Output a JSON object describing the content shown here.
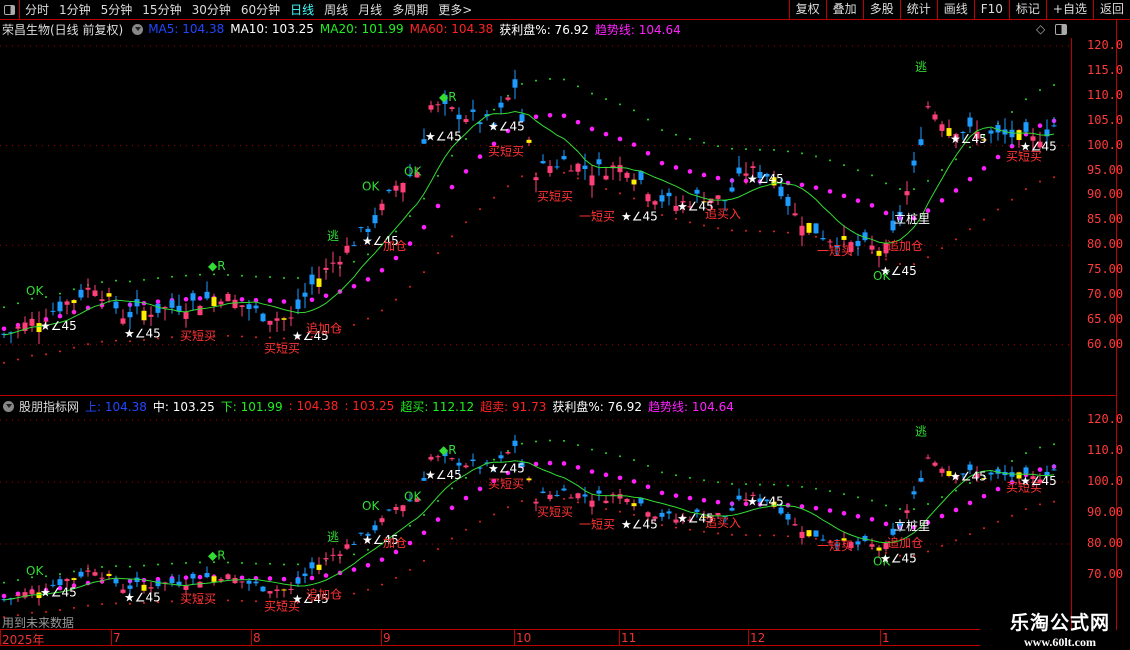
{
  "toolbar": {
    "periods": [
      "分时",
      "1分钟",
      "5分钟",
      "15分钟",
      "30分钟",
      "60分钟",
      "日线",
      "周线",
      "月线",
      "多周期",
      "更多>"
    ],
    "active_period": "日线",
    "buttons": [
      "复权",
      "叠加",
      "多股",
      "统计",
      "画线",
      "F10",
      "标记",
      "+自选",
      "返回"
    ]
  },
  "upper": {
    "title": "荣昌生物(日线 前复权)",
    "ma5": "MA5: 104.38",
    "ma10": "MA10: 103.25",
    "ma20": "MA20: 101.99",
    "ma60": "MA60: 104.38",
    "profit": "获利盘%: 76.92",
    "trend": "趋势线: 104.64"
  },
  "lower": {
    "title": "股朋指标网",
    "up": "上: 104.38",
    "mid": "中: 103.25",
    "down": "下: 101.99",
    "v1": ": 104.38",
    "v2": ": 103.25",
    "overbuy": "超买: 112.12",
    "oversell": "超卖: 91.73",
    "profit": "获利盘%: 76.92",
    "trend": "趋势线: 104.64"
  },
  "footer": {
    "future_note": "用到未来数据",
    "dates": [
      "2025年",
      "7",
      "8",
      "9",
      "10",
      "11",
      "12",
      "1"
    ],
    "watermark_title": "乐淘公式网",
    "watermark_url": "www.60lt.com"
  },
  "colors": {
    "up": "#ff3f7a",
    "down": "#1e9bff",
    "ma": "#33dd33",
    "trend": "#ff22ff",
    "axis": "#ff3b3b"
  },
  "chart_data": {
    "type": "candlestick",
    "upper_axis": {
      "ylim": [
        55,
        123
      ],
      "ticks": [
        "120.0",
        "115.0",
        "110.0",
        "105.0",
        "100.0",
        "95.00",
        "90.00",
        "85.00",
        "80.00",
        "75.00",
        "70.00",
        "65.00",
        "60.00"
      ]
    },
    "lower_axis": {
      "ylim": [
        65,
        123
      ],
      "ticks": [
        "120.0",
        "110.0",
        "100.0",
        "90.00",
        "80.00",
        "70.00"
      ]
    },
    "close_keypoints": [
      [
        0,
        62
      ],
      [
        6,
        66
      ],
      [
        13,
        72
      ],
      [
        17,
        66
      ],
      [
        26,
        68
      ],
      [
        31,
        70
      ],
      [
        37,
        66
      ],
      [
        41,
        65
      ],
      [
        44,
        72
      ],
      [
        48,
        78
      ],
      [
        53,
        85
      ],
      [
        56,
        92
      ],
      [
        59,
        95
      ],
      [
        61,
        108
      ],
      [
        66,
        106
      ],
      [
        70,
        104
      ],
      [
        73,
        112
      ],
      [
        74,
        105
      ],
      [
        76,
        95
      ],
      [
        80,
        97
      ],
      [
        84,
        95
      ],
      [
        89,
        96
      ],
      [
        93,
        90
      ],
      [
        96,
        88
      ],
      [
        100,
        90
      ],
      [
        103,
        89
      ],
      [
        106,
        95
      ],
      [
        110,
        94
      ],
      [
        113,
        86
      ],
      [
        117,
        82
      ],
      [
        121,
        80
      ],
      [
        126,
        79
      ],
      [
        127,
        82
      ],
      [
        130,
        95
      ],
      [
        132,
        108
      ],
      [
        135,
        104
      ],
      [
        140,
        102
      ],
      [
        144,
        102
      ],
      [
        147,
        101
      ],
      [
        150,
        104
      ]
    ],
    "annotations": [
      {
        "i": 4,
        "p": 70,
        "t": "OK",
        "c": "#33dd33"
      },
      {
        "i": 6,
        "p": 63,
        "t": "★∠45",
        "c": "#fff"
      },
      {
        "i": 18,
        "p": 61.5,
        "t": "★∠45",
        "c": "#fff"
      },
      {
        "i": 26,
        "p": 61,
        "t": "买短买",
        "c": "#ff3333"
      },
      {
        "i": 30,
        "p": 75,
        "t": "◆R",
        "c": "#33dd33"
      },
      {
        "i": 38,
        "p": 58.5,
        "t": "买短买",
        "c": "#ff3333"
      },
      {
        "i": 42,
        "p": 61,
        "t": "★∠45",
        "c": "#fff"
      },
      {
        "i": 44,
        "p": 62.5,
        "t": "追加仓",
        "c": "#ff3333"
      },
      {
        "i": 47,
        "p": 81,
        "t": "逃",
        "c": "#33dd33"
      },
      {
        "i": 52,
        "p": 80,
        "t": "★∠45",
        "c": "#fff"
      },
      {
        "i": 52,
        "p": 91,
        "t": "OK",
        "c": "#33dd33"
      },
      {
        "i": 55,
        "p": 79,
        "t": "加仓",
        "c": "#ff3333"
      },
      {
        "i": 58,
        "p": 94,
        "t": "OK",
        "c": "#33dd33"
      },
      {
        "i": 61,
        "p": 101,
        "t": "★∠45",
        "c": "#fff"
      },
      {
        "i": 63,
        "p": 109,
        "t": "◆R",
        "c": "#33dd33"
      },
      {
        "i": 70,
        "p": 98,
        "t": "买短买",
        "c": "#ff3333"
      },
      {
        "i": 70,
        "p": 103,
        "t": "★∠45",
        "c": "#fff"
      },
      {
        "i": 77,
        "p": 89,
        "t": "买短买",
        "c": "#ff3333"
      },
      {
        "i": 83,
        "p": 85,
        "t": "一短买",
        "c": "#ff3333"
      },
      {
        "i": 89,
        "p": 85,
        "t": "★∠45",
        "c": "#fff"
      },
      {
        "i": 97,
        "p": 87,
        "t": "★∠45",
        "c": "#fff"
      },
      {
        "i": 101,
        "p": 85.5,
        "t": "追买入",
        "c": "#ff3333"
      },
      {
        "i": 107,
        "p": 92.5,
        "t": "★∠45",
        "c": "#fff"
      },
      {
        "i": 117,
        "p": 78,
        "t": "一短买",
        "c": "#ff3333"
      },
      {
        "i": 125,
        "p": 73,
        "t": "OK",
        "c": "#33dd33"
      },
      {
        "i": 126,
        "p": 74,
        "t": "★∠45",
        "c": "#fff"
      },
      {
        "i": 127,
        "p": 79,
        "t": "追加仓",
        "c": "#ff3333"
      },
      {
        "i": 128,
        "p": 84.5,
        "t": "立桩里",
        "c": "#fff"
      },
      {
        "i": 131,
        "p": 115,
        "t": "逃",
        "c": "#33dd33"
      },
      {
        "i": 136,
        "p": 100.5,
        "t": "★∠45",
        "c": "#fff"
      },
      {
        "i": 144,
        "p": 97,
        "t": "买短买",
        "c": "#ff3333"
      },
      {
        "i": 146,
        "p": 99,
        "t": "★∠45",
        "c": "#fff"
      }
    ]
  }
}
